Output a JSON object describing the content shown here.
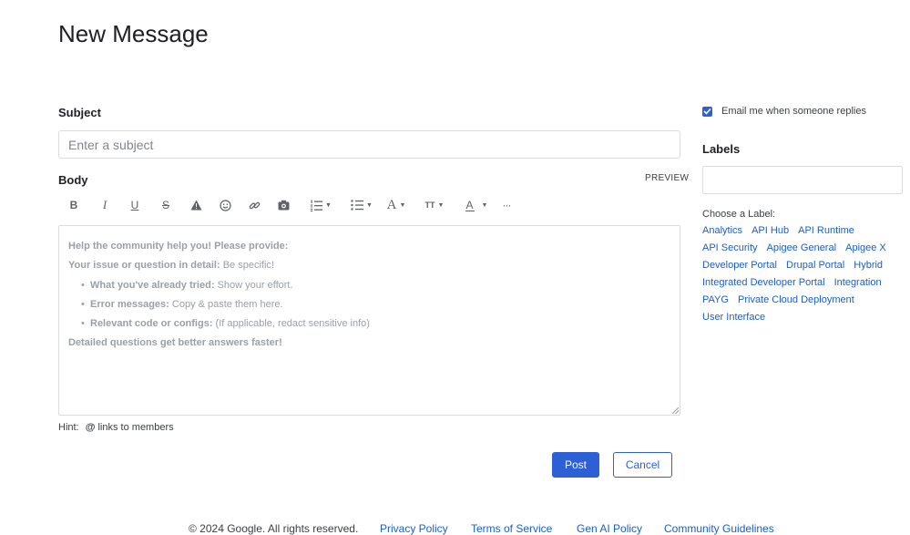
{
  "page": {
    "title": "New Message"
  },
  "subject": {
    "label": "Subject",
    "placeholder": "Enter a subject"
  },
  "body": {
    "label": "Body",
    "preview": "PREVIEW",
    "intro": "Help the community help you! Please provide:",
    "detail_bold": "Your issue or question in detail:",
    "detail_text": "Be specific!",
    "bullets": [
      {
        "bold": "What you've already tried:",
        "text": "Show your effort."
      },
      {
        "bold": "Error messages:",
        "text": "Copy & paste them here."
      },
      {
        "bold": "Relevant code or configs:",
        "text": "(If applicable, redact sensitive info)"
      }
    ],
    "outro": "Detailed questions get better answers faster!"
  },
  "toolbar": {
    "bold": "B",
    "italic": "I",
    "underline": "U",
    "strike": "S",
    "font": "A",
    "text_size": "TT",
    "text_color": "A",
    "more": "···"
  },
  "hint": {
    "prefix": "Hint:",
    "at": "@",
    "text": "links to members"
  },
  "actions": {
    "post": "Post",
    "cancel": "Cancel"
  },
  "sidebar": {
    "email_label": "Email me when someone replies",
    "email_checked": true,
    "labels_title": "Labels",
    "choose_label": "Choose a Label:",
    "labels": [
      "Analytics",
      "API Hub",
      "API Runtime",
      "API Security",
      "Apigee General",
      "Apigee X",
      "Developer Portal",
      "Drupal Portal",
      "Hybrid",
      "Integrated Developer Portal",
      "Integration",
      "PAYG",
      "Private Cloud Deployment",
      "User Interface"
    ]
  },
  "footer": {
    "copyright": "© 2024 Google. All rights reserved.",
    "privacy": "Privacy Policy",
    "terms": "Terms of Service",
    "genai": "Gen AI Policy",
    "guidelines": "Community Guidelines"
  },
  "colors": {
    "accent": "#2c60d4",
    "link": "#1a5fc9",
    "border": "#dadce0",
    "placeholder_text": "#9aa0a6"
  }
}
